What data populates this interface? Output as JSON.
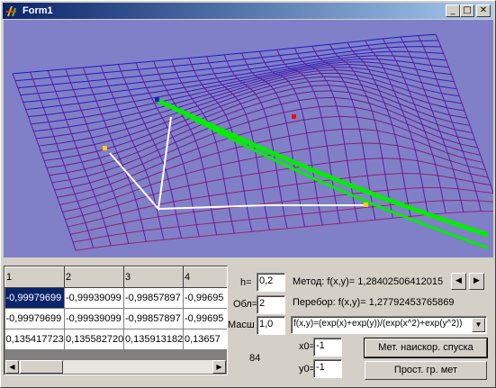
{
  "window": {
    "title": "Form1",
    "icon": "app-icon",
    "minimize_glyph": "_",
    "maximize_glyph": "□",
    "close_glyph": "✕"
  },
  "colors": {
    "titlebar_start": "#0a246a",
    "titlebar_end": "#a6caf0",
    "plot_background": "#8080c8",
    "mesh_far": "#1a1acc",
    "mesh_near": "#a0206a",
    "descent_path": "#00ee00",
    "search_path": "#ffffff",
    "marker_red": "#ff0000",
    "marker_yellow": "#ffcc00"
  },
  "grid": {
    "headers": [
      "1",
      "2",
      "3",
      "4"
    ],
    "rows": [
      [
        "-0,99979699",
        "-0,99939099",
        "-0,99857897",
        "-0,99695"
      ],
      [
        "-0,99979699",
        "-0,99939099",
        "-0,99857897",
        "-0,99695"
      ],
      [
        "0,135417723",
        "0,135582720",
        "0,135913182",
        "0,13657"
      ]
    ],
    "selected_cell": "-0,99979699"
  },
  "params": {
    "h_label": "h=",
    "h_value": "0,2",
    "obl_label": "Обл=",
    "obl_value": "2",
    "mash_label": "Масш",
    "mash_value": "1,0",
    "count": "84",
    "x0_label": "x0=",
    "x0_value": "-1",
    "y0_label": "y0=",
    "y0_value": "-1"
  },
  "results": {
    "method_text": "Метод: f(x,y)=  1,28402506412015",
    "search_text": "Перебор: f(x,y)= 1,27792453765869"
  },
  "function_select": {
    "selected": "f(x,y)=(exp(x)+exp(y))/(exp(x^2)+exp(y^2))"
  },
  "buttons": {
    "steepest_descent": "Мет. наискор. спуска",
    "simple_search": "Прост. гр. мет"
  }
}
